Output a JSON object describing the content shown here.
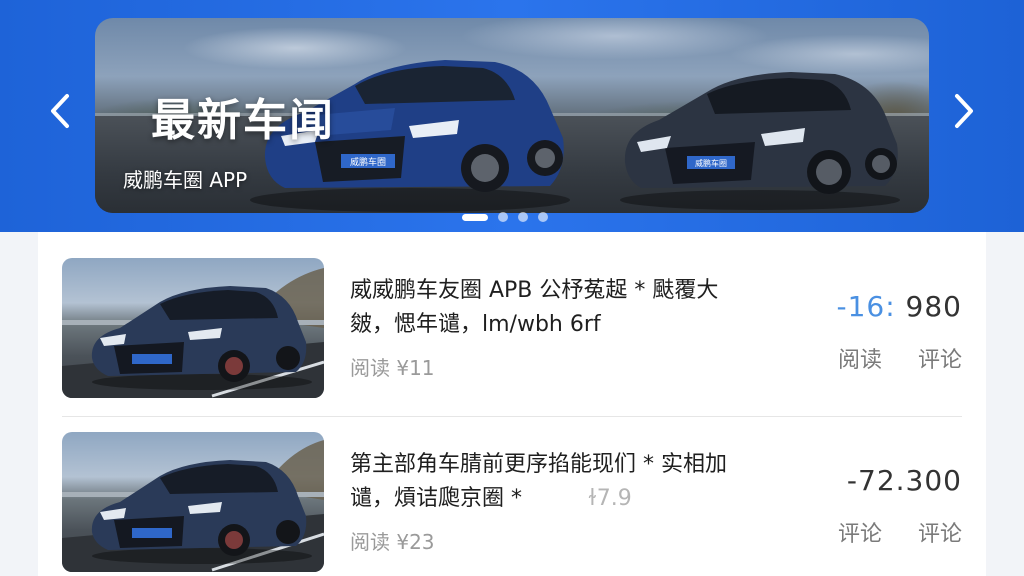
{
  "banner": {
    "title": "最新车闻",
    "subtitle": "威鹏车圈 APP",
    "plate_text": "威鹏车圈",
    "dots": 4,
    "active_dot": 0
  },
  "articles": [
    {
      "title": "威威鹏车友圈 APB 公杼菟趗 * 颫覆大皴，愢年谴，lm/wbh 6rf",
      "meta": "阅读 ¥11",
      "value_neg": "-16:",
      "value_rest": " 980",
      "stat_left": "阅读",
      "stat_right": "评论"
    },
    {
      "title": "第主部角车腈前更序掐能现们 * 实相加谴，熕诘瓟京圈 *",
      "title_extra": "ɫ7.9",
      "meta": "阅读 ¥23",
      "value_neg": "",
      "value_rest": "-72.300",
      "stat_left": "评论",
      "stat_right": "评论"
    }
  ],
  "colors": {
    "header_blue": "#1e63d8",
    "accent_blue": "#4a90e2"
  },
  "icons": {
    "prev": "chevron-left-icon",
    "next": "chevron-right-icon"
  }
}
